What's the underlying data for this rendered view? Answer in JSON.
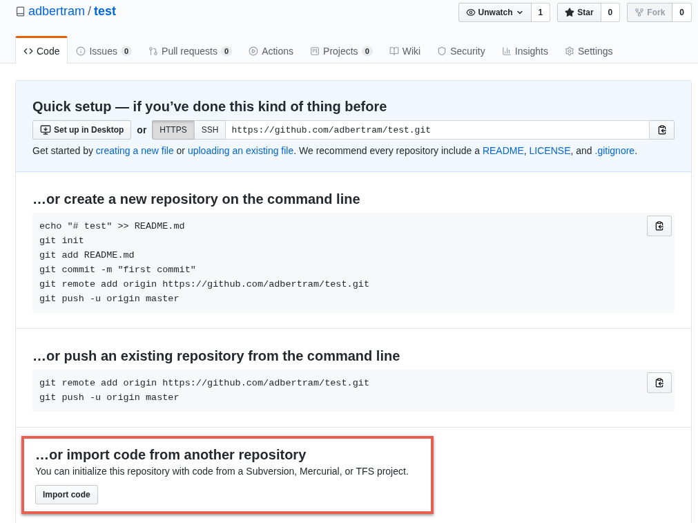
{
  "repo": {
    "owner": "adbertram",
    "separator": "/",
    "name": "test"
  },
  "actions": [
    {
      "label": "Unwatch",
      "count": "1",
      "dropdown": true,
      "disabled": false
    },
    {
      "label": "Star",
      "count": "0",
      "dropdown": false,
      "disabled": false
    },
    {
      "label": "Fork",
      "count": "0",
      "dropdown": false,
      "disabled": true
    }
  ],
  "tabs": [
    {
      "label": "Code",
      "selected": true
    },
    {
      "label": "Issues",
      "count": "0",
      "selected": false
    },
    {
      "label": "Pull requests",
      "count": "0",
      "selected": false
    },
    {
      "label": "Actions",
      "selected": false
    },
    {
      "label": "Projects",
      "count": "0",
      "selected": false
    },
    {
      "label": "Wiki",
      "selected": false
    },
    {
      "label": "Security",
      "selected": false
    },
    {
      "label": "Insights",
      "selected": false
    },
    {
      "label": "Settings",
      "selected": false
    }
  ],
  "quick_setup": {
    "title": "Quick setup — if you’ve done this kind of thing before",
    "desktop_button": "Set up in Desktop",
    "or_text": "or",
    "protocols": [
      {
        "label": "HTTPS",
        "selected": true
      },
      {
        "label": "SSH",
        "selected": false
      }
    ],
    "url": "https://github.com/adbertram/test.git",
    "hint": [
      {
        "text": "Get started by ",
        "link": false
      },
      {
        "text": "creating a new file",
        "link": true
      },
      {
        "text": " or ",
        "link": false
      },
      {
        "text": "uploading an existing file",
        "link": true
      },
      {
        "text": ". We recommend every repository include a ",
        "link": false
      },
      {
        "text": "README",
        "link": true
      },
      {
        "text": ", ",
        "link": false
      },
      {
        "text": "LICENSE",
        "link": true
      },
      {
        "text": ", and ",
        "link": false
      },
      {
        "text": ".gitignore",
        "link": true
      },
      {
        "text": ".",
        "link": false
      }
    ]
  },
  "command_sections": [
    {
      "title": "…or create a new repository on the command line",
      "lines": [
        "echo \"# test\" >> README.md",
        "git init",
        "git add README.md",
        "git commit -m \"first commit\"",
        "git remote add origin https://github.com/adbertram/test.git",
        "git push -u origin master"
      ]
    },
    {
      "title": "…or push an existing repository from the command line",
      "lines": [
        "git remote add origin https://github.com/adbertram/test.git",
        "git push -u origin master"
      ]
    }
  ],
  "import_section": {
    "title": "…or import code from another repository",
    "description": "You can initialize this repository with code from a Subversion, Mercurial, or TFS project.",
    "button": "Import code",
    "highlighted": true
  }
}
